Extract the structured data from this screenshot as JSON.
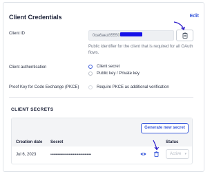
{
  "header": {
    "title": "Client Credentials",
    "edit_label": "Edit"
  },
  "client_id": {
    "label": "Client ID",
    "value": "0oa6aez85550",
    "help": "Public identifier for the client that is required for all OAuth flows."
  },
  "client_authentication": {
    "label": "Client authentication",
    "options": [
      {
        "label": "Client secret",
        "selected": true
      },
      {
        "label": "Public key / Private key",
        "selected": false
      }
    ]
  },
  "pkce": {
    "label": "Proof Key for Code Exchange (PKCE)",
    "option_label": "Require PKCE as additional verification"
  },
  "secrets": {
    "section_title": "CLIENT SECRETS",
    "generate_label": "Generate new secret",
    "columns": [
      "Creation date",
      "Secret",
      "Status"
    ],
    "rows": [
      {
        "creation_date": "Jul 6, 2023",
        "secret": "••••••••••••••••••••••••••••••••••••••",
        "status": "Active"
      }
    ]
  },
  "colors": {
    "accent": "#3b5bdb",
    "annotation": "#2817c9"
  }
}
